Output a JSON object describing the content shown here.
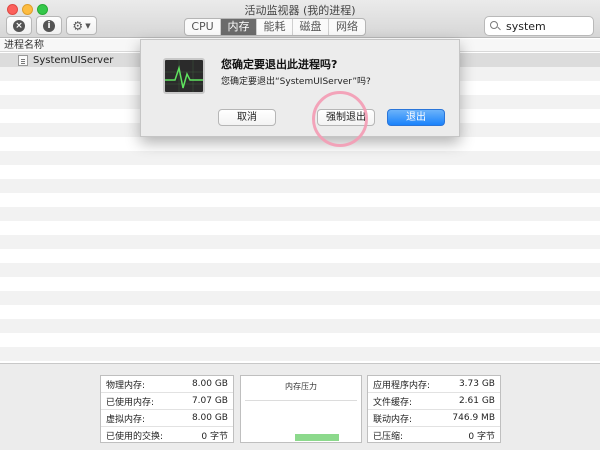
{
  "window": {
    "title": "活动监视器 (我的进程)"
  },
  "toolbar": {
    "info_symbol": "i",
    "stop_symbol": "×",
    "tabs": [
      "CPU",
      "内存",
      "能耗",
      "磁盘",
      "网络"
    ],
    "active_tab": "内存",
    "search_value": "system"
  },
  "list": {
    "column_header": "进程名称",
    "rows": [
      {
        "name": "SystemUIServer",
        "selected": true
      }
    ]
  },
  "dialog": {
    "title": "您确定要退出此进程吗?",
    "message": "您确定要退出“SystemUIServer”吗?",
    "cancel_label": "取消",
    "force_quit_label": "强制退出",
    "quit_label": "退出"
  },
  "memory": {
    "left": [
      {
        "label": "物理内存:",
        "value": "8.00 GB"
      },
      {
        "label": "已使用内存:",
        "value": "7.07 GB"
      },
      {
        "label": "虚拟内存:",
        "value": "8.00 GB"
      },
      {
        "label": "已使用的交换:",
        "value": "0 字节"
      }
    ],
    "pressure_title": "内存压力",
    "right": [
      {
        "label": "应用程序内存:",
        "value": "3.73 GB"
      },
      {
        "label": "文件缓存:",
        "value": "2.61 GB"
      },
      {
        "label": "联动内存:",
        "value": "746.9 MB"
      },
      {
        "label": "已压缩:",
        "value": "0 字节"
      }
    ]
  },
  "colors": {
    "accent": "#1a82fb",
    "pressure": "#8cd98c",
    "highlight": "#f49bb4"
  }
}
